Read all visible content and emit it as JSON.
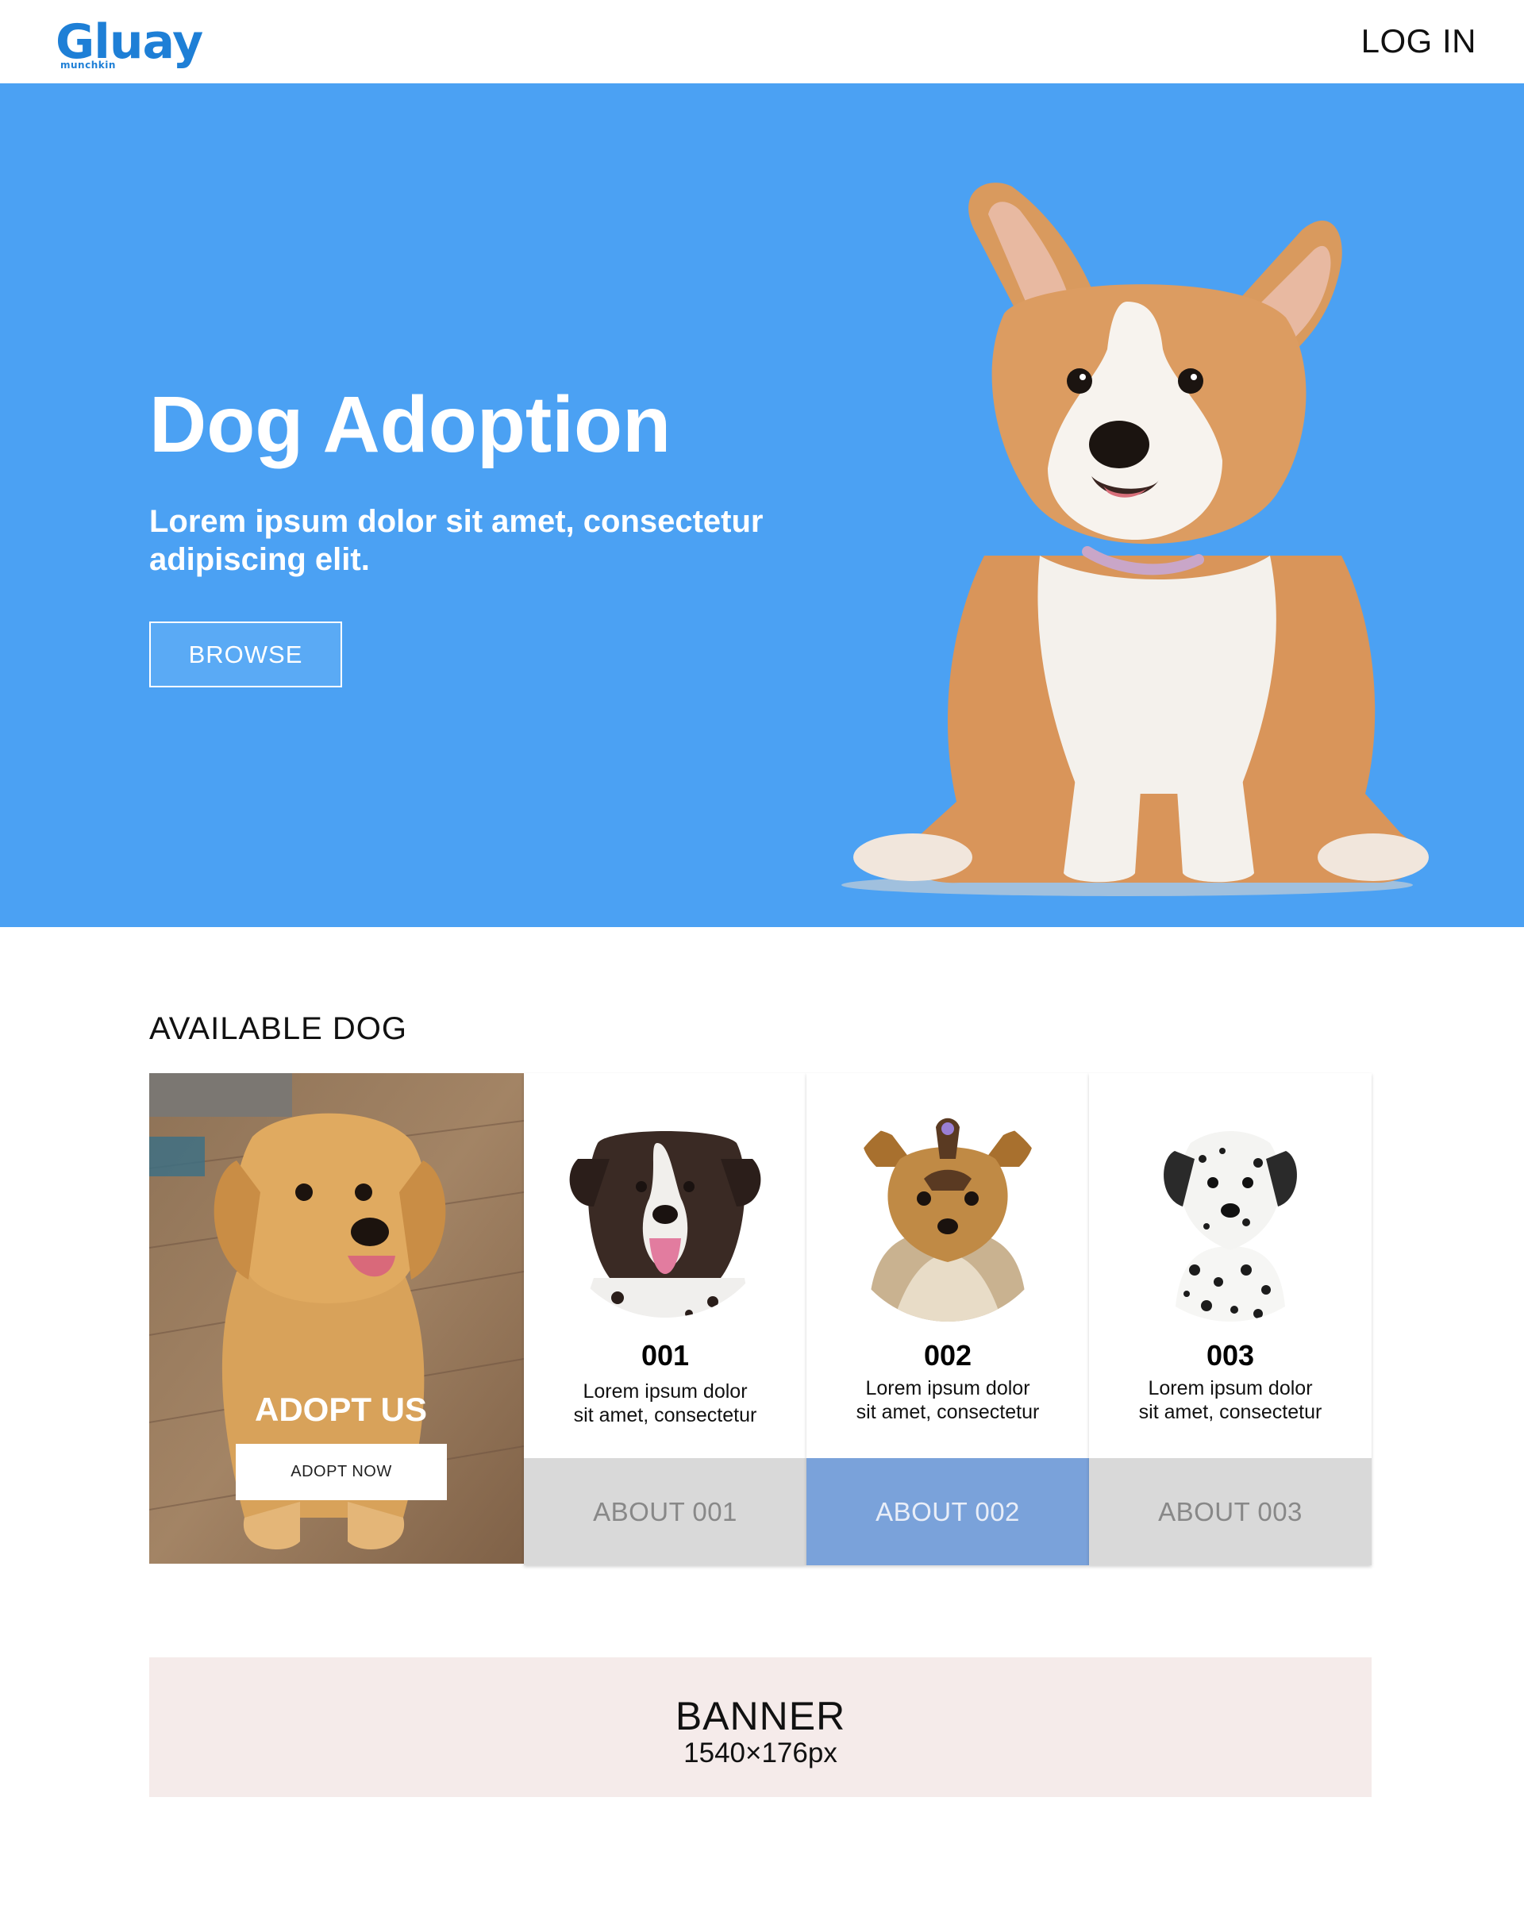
{
  "header": {
    "logo_main": "Gluay",
    "logo_sub": "munchkin",
    "login_label": "LOG IN"
  },
  "hero": {
    "title": "Dog Adoption",
    "subtitle": "Lorem ipsum dolor sit amet, consectetur adipiscing elit.",
    "browse_label": "BROWSE",
    "background_color": "#4ba1f3"
  },
  "available": {
    "title": "AVAILABLE DOG",
    "adopt_card": {
      "title": "ADOPT US",
      "button_label": "ADOPT NOW"
    },
    "dogs": [
      {
        "number": "001",
        "desc_line1": "Lorem ipsum dolor",
        "desc_line2": "sit amet, consectetur",
        "about_label": "ABOUT 001",
        "active": false
      },
      {
        "number": "002",
        "desc_line1": "Lorem ipsum dolor",
        "desc_line2": "sit amet, consectetur",
        "about_label": "ABOUT 002",
        "active": true
      },
      {
        "number": "003",
        "desc_line1": "Lorem ipsum dolor",
        "desc_line2": "sit amet, consectetur",
        "about_label": "ABOUT 003",
        "active": false
      }
    ]
  },
  "banner": {
    "title": "BANNER",
    "size": "1540×176px"
  },
  "colors": {
    "brand_blue": "#1e7fd6",
    "hero_blue": "#4ba1f3",
    "about_active": "#7aa2da",
    "about_inactive": "#d9d9d9",
    "banner_bg": "#f5ebea"
  }
}
